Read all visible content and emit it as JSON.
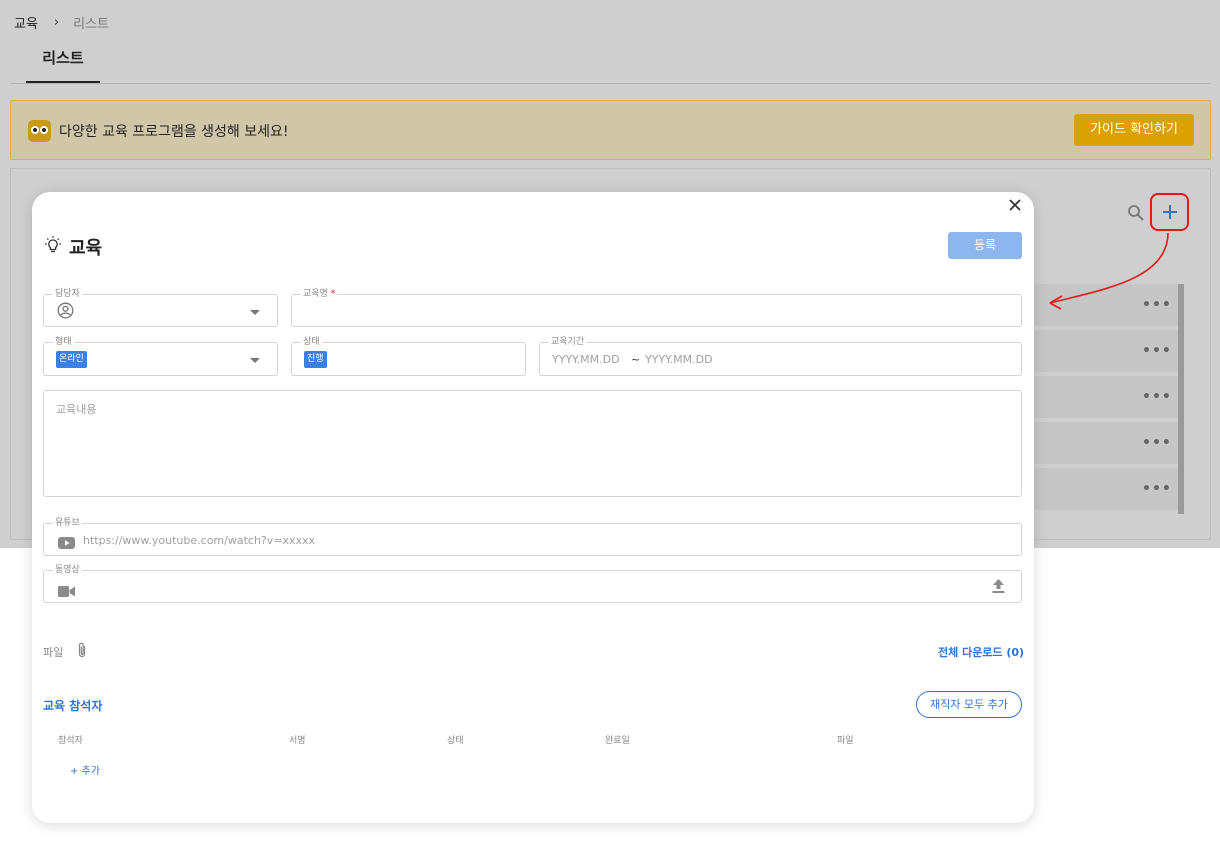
{
  "breadcrumb": {
    "root": "교육",
    "separator": "›",
    "current": "리스트"
  },
  "tabs": [
    {
      "label": "리스트"
    }
  ],
  "banner": {
    "message": "다양한 교육 프로그램을 생성해 보세요!",
    "guide_button": "가이드 확인하기"
  },
  "list": {
    "row_more": "•••",
    "icons": {
      "search": "search-icon",
      "add": "plus-icon"
    }
  },
  "modal": {
    "title": "교육",
    "title_icon": "lightbulb-icon",
    "register_button": "등록",
    "fields": {
      "manager": {
        "label": "담당자",
        "icon": "user-circle-icon"
      },
      "name": {
        "label": "교육명",
        "required_mark": "*",
        "value": ""
      },
      "type": {
        "label": "형태",
        "value": "온라인"
      },
      "status": {
        "label": "상태",
        "value": "진행"
      },
      "period": {
        "label": "교육기간",
        "start_placeholder": "YYYY.MM.DD",
        "separator": "~",
        "end_placeholder": "YYYY.MM.DD"
      },
      "content": {
        "placeholder": "교육내용"
      },
      "youtube": {
        "label": "유튜브",
        "placeholder": "https://www.youtube.com/watch?v=xxxxx",
        "icon": "youtube-icon"
      },
      "video": {
        "label": "동영상",
        "icon": "video-camera-icon",
        "upload_icon": "upload-icon"
      }
    },
    "files": {
      "label": "파일",
      "download_all": "전체 다운로드 (0)"
    },
    "participants": {
      "title": "교육 참석자",
      "add_all_button": "재직자 모두 추가",
      "columns": [
        "참석자",
        "서명",
        "상태",
        "완료일",
        "파일"
      ],
      "add_link": "+ 추가"
    }
  },
  "colors": {
    "accent": "#2f73d8",
    "chip": "#3b80e6",
    "banner_button": "#d9a102",
    "annotation": "#e11a1a"
  }
}
